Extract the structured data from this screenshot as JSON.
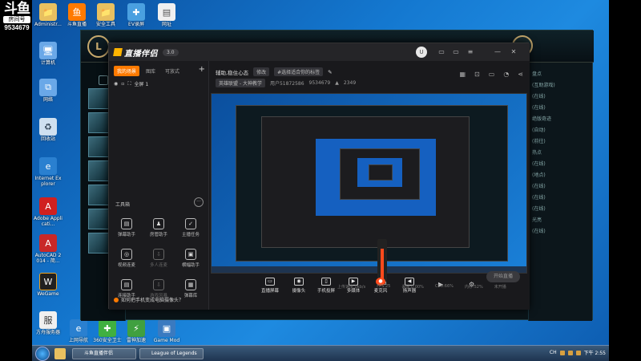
{
  "watermark": {
    "logo": "斗鱼",
    "room_label": "房间号",
    "room_id": "9534679"
  },
  "desktop_icons": [
    {
      "label": "Administr...",
      "icon": "user-folder-icon",
      "color": "#e8c060"
    },
    {
      "label": "斗鱼直播",
      "icon": "douyu-icon",
      "color": "#ff7a00"
    },
    {
      "label": "安全工具",
      "icon": "folder-icon",
      "color": "#e8c060"
    },
    {
      "label": "EV录屏",
      "icon": "ev-recorder-icon",
      "color": "#4aa0e0"
    },
    {
      "label": "网址",
      "icon": "document-icon",
      "color": "#f0f0f0"
    },
    {
      "label": "计算机",
      "icon": "computer-icon",
      "color": "#6aa8e8"
    },
    {
      "label": "网络",
      "icon": "network-icon",
      "color": "#6aa8e8"
    },
    {
      "label": "回收站",
      "icon": "recycle-bin-icon",
      "color": "#cfe0f0"
    },
    {
      "label": "Internet Explorer",
      "icon": "ie-icon",
      "color": "#2a80d0"
    },
    {
      "label": "Adobe Applicati...",
      "icon": "adobe-icon",
      "color": "#d02020"
    },
    {
      "label": "AutoCAD 2014 - 简...",
      "icon": "autocad-icon",
      "color": "#c82828"
    },
    {
      "label": "WeGame",
      "icon": "wegame-icon",
      "color": "#202020"
    },
    {
      "label": "方舟服务器",
      "icon": "server-icon",
      "color": "#f0f0f0"
    },
    {
      "label": "上网导航",
      "icon": "nav-icon",
      "color": "#2a80d0"
    },
    {
      "label": "360安全卫士",
      "icon": "shield-icon",
      "color": "#40b040"
    },
    {
      "label": "雷神加速",
      "icon": "accelerator-icon",
      "color": "#40a040"
    },
    {
      "label": "Game Mod",
      "icon": "game-icon",
      "color": "#3a7ac0"
    }
  ],
  "lol_client": {
    "logo": "L",
    "right_panel": [
      "盘点",
      "(互助游戏)",
      "(在线)",
      "(在线)",
      "绝版奇迹",
      "(自动)",
      "(前往)",
      "热点",
      "(在线)",
      "(地点)",
      "(在线)",
      "(在线)",
      "(在线)",
      "光亮",
      "(在线)"
    ]
  },
  "app": {
    "logo": "直播伴侣",
    "version": "3.0",
    "avatar": "U",
    "window_controls": [
      "minimize-icon",
      "restore-icon",
      "maximize-icon",
      "close-icon",
      "menu-icon"
    ],
    "sidebar": {
      "tabs": [
        {
          "label": "我的场景",
          "active": true
        },
        {
          "label": "图库",
          "active": false
        },
        {
          "label": "可放式",
          "active": false
        }
      ],
      "add": "+",
      "scene": "全屏 1",
      "tools_title": "工具箱",
      "tools_more": "···",
      "tools": [
        {
          "label": "弹幕助手",
          "icon": "▤",
          "dim": false
        },
        {
          "label": "房管助手",
          "icon": "♟",
          "dim": false
        },
        {
          "label": "主播任务",
          "icon": "✓",
          "dim": false
        },
        {
          "label": "视频连麦",
          "icon": "◎",
          "dim": false
        },
        {
          "label": "多人连麦",
          "icon": "⇩",
          "dim": true
        },
        {
          "label": "横幅助手",
          "icon": "▣",
          "dim": false
        },
        {
          "label": "连接助手",
          "icon": "▤",
          "dim": false
        },
        {
          "label": "游戏风暴",
          "icon": "⇩",
          "dim": true
        },
        {
          "label": "弹幕库",
          "icon": "▦",
          "dim": false
        }
      ]
    },
    "header": {
      "room_title": "辅助,稳住心态",
      "edit": "修改",
      "tag": "#选择适合你的标签",
      "category": "英雄联盟 - 大神教学",
      "user_id": "用户51872586",
      "room_id": "9534679",
      "popularity": "2349",
      "icons": [
        "layout-icon",
        "lock-icon",
        "share-screen-icon",
        "bell-icon",
        "share-icon"
      ]
    },
    "controls": [
      {
        "label": "直播屏幕",
        "icon": "▭"
      },
      {
        "label": "摄像头",
        "icon": "◉"
      },
      {
        "label": "手机投屏",
        "icon": "▯"
      },
      {
        "label": "多媒体",
        "icon": "▶"
      },
      {
        "label": "麦克风",
        "icon": "●"
      },
      {
        "label": "扬声器",
        "icon": "◀"
      }
    ],
    "mic_volume": 100,
    "live_button": "开始直播",
    "status": [
      "上传速度:0kb/s",
      "FPS:25",
      "丢帧:0.00%",
      "CPU:66%",
      "内存:52%",
      "未开播"
    ],
    "hint": "如何把手机变成电脑摄像头？"
  },
  "taskbar": {
    "buttons": [
      "斗鱼直播伴侣",
      "League of Legends"
    ],
    "time": "下午 2:55",
    "lang": "CH"
  }
}
